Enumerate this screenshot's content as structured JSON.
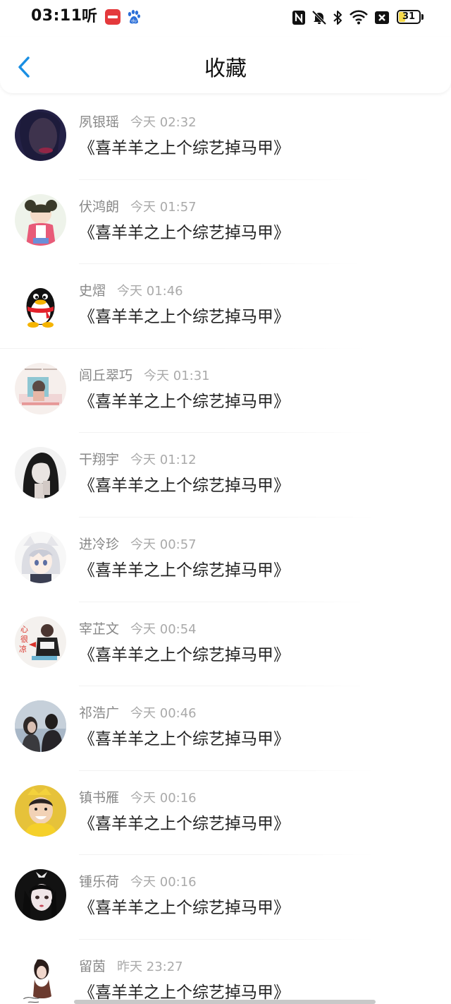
{
  "status_bar": {
    "time": "03:11",
    "battery": "31",
    "icons": [
      "ting-app-icon",
      "xiaohongshu-icon",
      "baidu-icon",
      "nfc-icon",
      "mute-bell-icon",
      "bluetooth-icon",
      "wifi-icon",
      "sim-off-icon",
      "battery-icon"
    ]
  },
  "nav": {
    "back_icon": "chevron-left-icon",
    "title": "收藏"
  },
  "colors": {
    "accent": "#1a8fe3",
    "title_text": "#222222",
    "name_text": "#888888",
    "time_text": "#aaaaaa"
  },
  "favorites": [
    {
      "name": "夙银瑶",
      "time": "今天 02:32",
      "title": "《喜羊羊之上个综艺掉马甲》"
    },
    {
      "name": "伏鸿朗",
      "time": "今天 01:57",
      "title": "《喜羊羊之上个综艺掉马甲》"
    },
    {
      "name": "史熠",
      "time": "今天 01:46",
      "title": "《喜羊羊之上个综艺掉马甲》"
    },
    {
      "name": "闾丘翠巧",
      "time": "今天 01:31",
      "title": "《喜羊羊之上个综艺掉马甲》"
    },
    {
      "name": "干翔宇",
      "time": "今天 01:12",
      "title": "《喜羊羊之上个综艺掉马甲》"
    },
    {
      "name": "进冷珍",
      "time": "今天 00:57",
      "title": "《喜羊羊之上个综艺掉马甲》"
    },
    {
      "name": "宰芷文",
      "time": "今天 00:54",
      "title": "《喜羊羊之上个综艺掉马甲》"
    },
    {
      "name": "祁浩广",
      "time": "今天 00:46",
      "title": "《喜羊羊之上个综艺掉马甲》"
    },
    {
      "name": "镇书雁",
      "time": "今天 00:16",
      "title": "《喜羊羊之上个综艺掉马甲》"
    },
    {
      "name": "锺乐荷",
      "time": "今天 00:16",
      "title": "《喜羊羊之上个综艺掉马甲》"
    },
    {
      "name": "留茵",
      "time": "昨天 23:27",
      "title": "《喜羊羊之上个综艺掉马甲》"
    }
  ]
}
